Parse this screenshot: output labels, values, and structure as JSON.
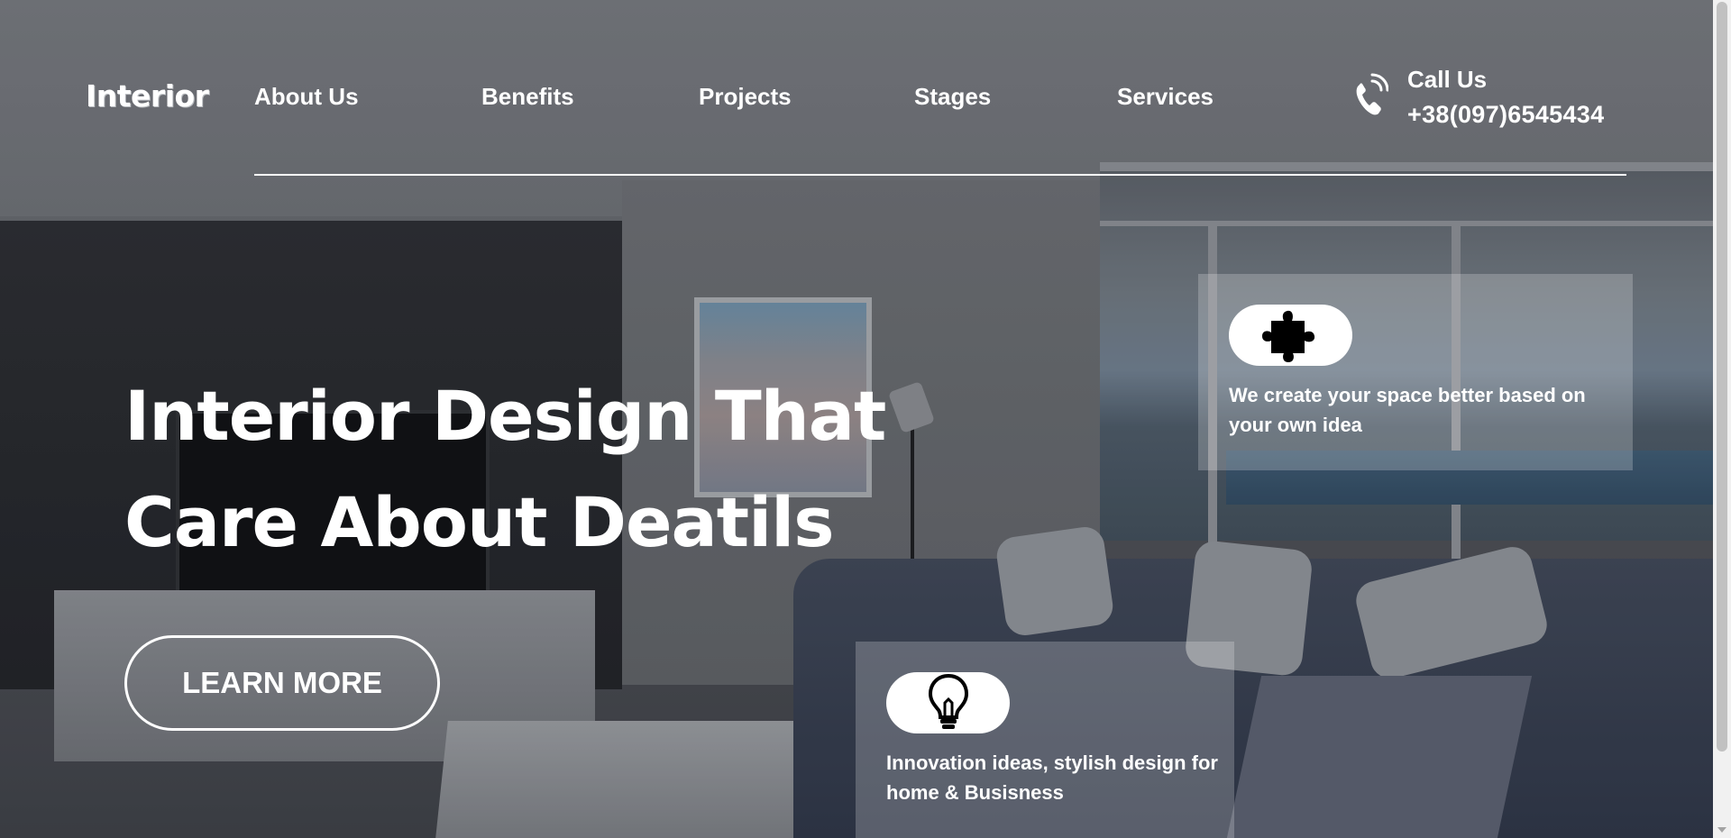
{
  "brand": {
    "logo_text": "Interior"
  },
  "nav": {
    "items": [
      {
        "label": "About Us"
      },
      {
        "label": "Benefits"
      },
      {
        "label": "Projects"
      },
      {
        "label": "Stages"
      },
      {
        "label": "Services"
      }
    ]
  },
  "contact": {
    "label": "Call Us",
    "phone": "+38(097)6545434",
    "icon": "phone-icon"
  },
  "hero": {
    "headline_line1": "Interior Design That",
    "headline_line2": "Care About Deatils",
    "cta_label": "LEARN MORE"
  },
  "features": [
    {
      "icon": "puzzle-piece-icon",
      "text": "We create your space better based on your own idea"
    },
    {
      "icon": "lightbulb-icon",
      "text": "Innovation ideas, stylish design for home & Busisness"
    }
  ],
  "colors": {
    "text": "#ffffff",
    "card_bg": "rgba(255,255,255,0.22)",
    "pill_bg": "#ffffff",
    "icon": "#000000"
  }
}
